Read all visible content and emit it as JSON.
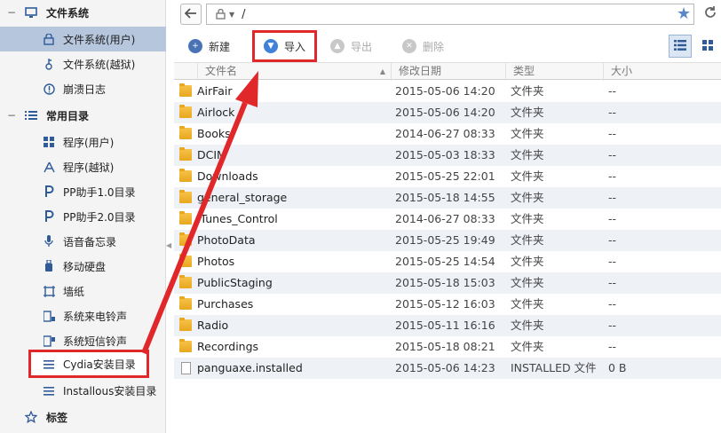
{
  "sidebar": {
    "filesystem_group": {
      "toggle": "−",
      "label": "文件系统"
    },
    "filesystem_items": [
      {
        "label": "文件系统(用户)",
        "icon": "lock-icon"
      },
      {
        "label": "文件系统(越狱)",
        "icon": "jailbreak-icon"
      },
      {
        "label": "崩溃日志",
        "icon": "crash-log-icon"
      }
    ],
    "common_group": {
      "toggle": "−",
      "label": "常用目录"
    },
    "common_items": [
      {
        "label": "程序(用户)",
        "icon": "apps-grid-icon"
      },
      {
        "label": "程序(越狱)",
        "icon": "jailbreak-apps-icon"
      },
      {
        "label": "PP助手1.0目录",
        "icon": "pp-icon"
      },
      {
        "label": "PP助手2.0目录",
        "icon": "pp-icon"
      },
      {
        "label": "语音备忘录",
        "icon": "microphone-icon"
      },
      {
        "label": "移动硬盘",
        "icon": "usb-drive-icon"
      },
      {
        "label": "墙纸",
        "icon": "wallpaper-icon"
      },
      {
        "label": "系统来电铃声",
        "icon": "ringtone-icon"
      },
      {
        "label": "系统短信铃声",
        "icon": "sms-tone-icon"
      },
      {
        "label": "Cydia安装目录",
        "icon": "list-icon"
      },
      {
        "label": "Installous安装目录",
        "icon": "list-icon"
      }
    ],
    "bookmarks_group": {
      "toggle": "",
      "label": "标签"
    }
  },
  "address": {
    "path": "/"
  },
  "toolbar": {
    "new_label": "新建",
    "import_label": "导入",
    "export_label": "导出",
    "delete_label": "删除"
  },
  "table": {
    "columns": {
      "name": "文件名",
      "date": "修改日期",
      "type": "类型",
      "size": "大小"
    },
    "rows": [
      {
        "name": "AirFair",
        "date": "2015-05-06 14:20",
        "type": "文件夹",
        "size": "--",
        "kind": "folder"
      },
      {
        "name": "Airlock",
        "date": "2015-05-06 14:20",
        "type": "文件夹",
        "size": "--",
        "kind": "folder"
      },
      {
        "name": "Books",
        "date": "2014-06-27 08:33",
        "type": "文件夹",
        "size": "--",
        "kind": "folder"
      },
      {
        "name": "DCIM",
        "date": "2015-05-03 18:33",
        "type": "文件夹",
        "size": "--",
        "kind": "folder"
      },
      {
        "name": "Downloads",
        "date": "2015-05-25 22:01",
        "type": "文件夹",
        "size": "--",
        "kind": "folder"
      },
      {
        "name": "general_storage",
        "date": "2015-05-18 14:55",
        "type": "文件夹",
        "size": "--",
        "kind": "folder"
      },
      {
        "name": "iTunes_Control",
        "date": "2014-06-27 08:33",
        "type": "文件夹",
        "size": "--",
        "kind": "folder"
      },
      {
        "name": "PhotoData",
        "date": "2015-05-25 19:49",
        "type": "文件夹",
        "size": "--",
        "kind": "folder"
      },
      {
        "name": "Photos",
        "date": "2015-05-25 14:54",
        "type": "文件夹",
        "size": "--",
        "kind": "folder"
      },
      {
        "name": "PublicStaging",
        "date": "2015-05-18 15:03",
        "type": "文件夹",
        "size": "--",
        "kind": "folder"
      },
      {
        "name": "Purchases",
        "date": "2015-05-12 16:03",
        "type": "文件夹",
        "size": "--",
        "kind": "folder"
      },
      {
        "name": "Radio",
        "date": "2015-05-11 16:16",
        "type": "文件夹",
        "size": "--",
        "kind": "folder"
      },
      {
        "name": "Recordings",
        "date": "2015-05-18 08:21",
        "type": "文件夹",
        "size": "--",
        "kind": "folder"
      },
      {
        "name": "panguaxe.installed",
        "date": "2015-05-06 14:23",
        "type": "INSTALLED 文件",
        "size": "0 B",
        "kind": "file"
      }
    ]
  },
  "colors": {
    "annotation_red": "#e0282b",
    "selection": "#b6c6dd",
    "accent": "#3f82d8"
  }
}
